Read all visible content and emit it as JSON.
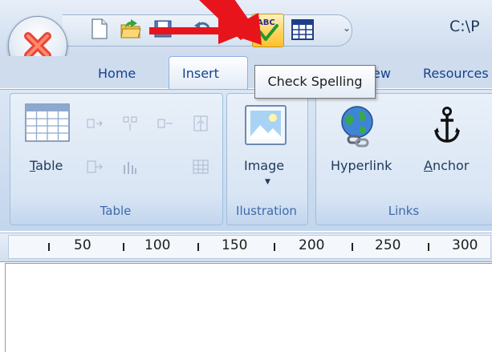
{
  "window": {
    "title": "C:\\P"
  },
  "quick_access": {
    "items": [
      "new-document-icon",
      "open-folder-icon",
      "save-icon",
      "undo-icon",
      "check-spelling-icon",
      "table-icon"
    ],
    "dropdown_glyph": "⌄"
  },
  "tabs": [
    {
      "label": "Home",
      "active": false
    },
    {
      "label": "Insert",
      "active": true
    },
    {
      "label": "View",
      "active": false
    },
    {
      "label": "Resources",
      "active": false
    }
  ],
  "ribbon": {
    "groups": [
      {
        "label": "Table",
        "buttons": [
          {
            "label": "Table",
            "mnemonic": "T",
            "rest": "able"
          }
        ]
      },
      {
        "label": "Ilustration",
        "buttons": [
          {
            "label": "Image"
          }
        ]
      },
      {
        "label": "Links",
        "buttons": [
          {
            "label": "Hyperlink"
          },
          {
            "label": "Anchor",
            "mnemonic": "A",
            "rest": "nchor"
          }
        ]
      }
    ]
  },
  "tooltip": {
    "text": "Check Spelling"
  },
  "ruler": {
    "labels": [
      "50",
      "100",
      "150",
      "200",
      "250",
      "300"
    ]
  },
  "colors": {
    "annotation_arrow": "#e8141c",
    "ribbon_text": "#15428b",
    "group_label": "#3e6aaa"
  }
}
